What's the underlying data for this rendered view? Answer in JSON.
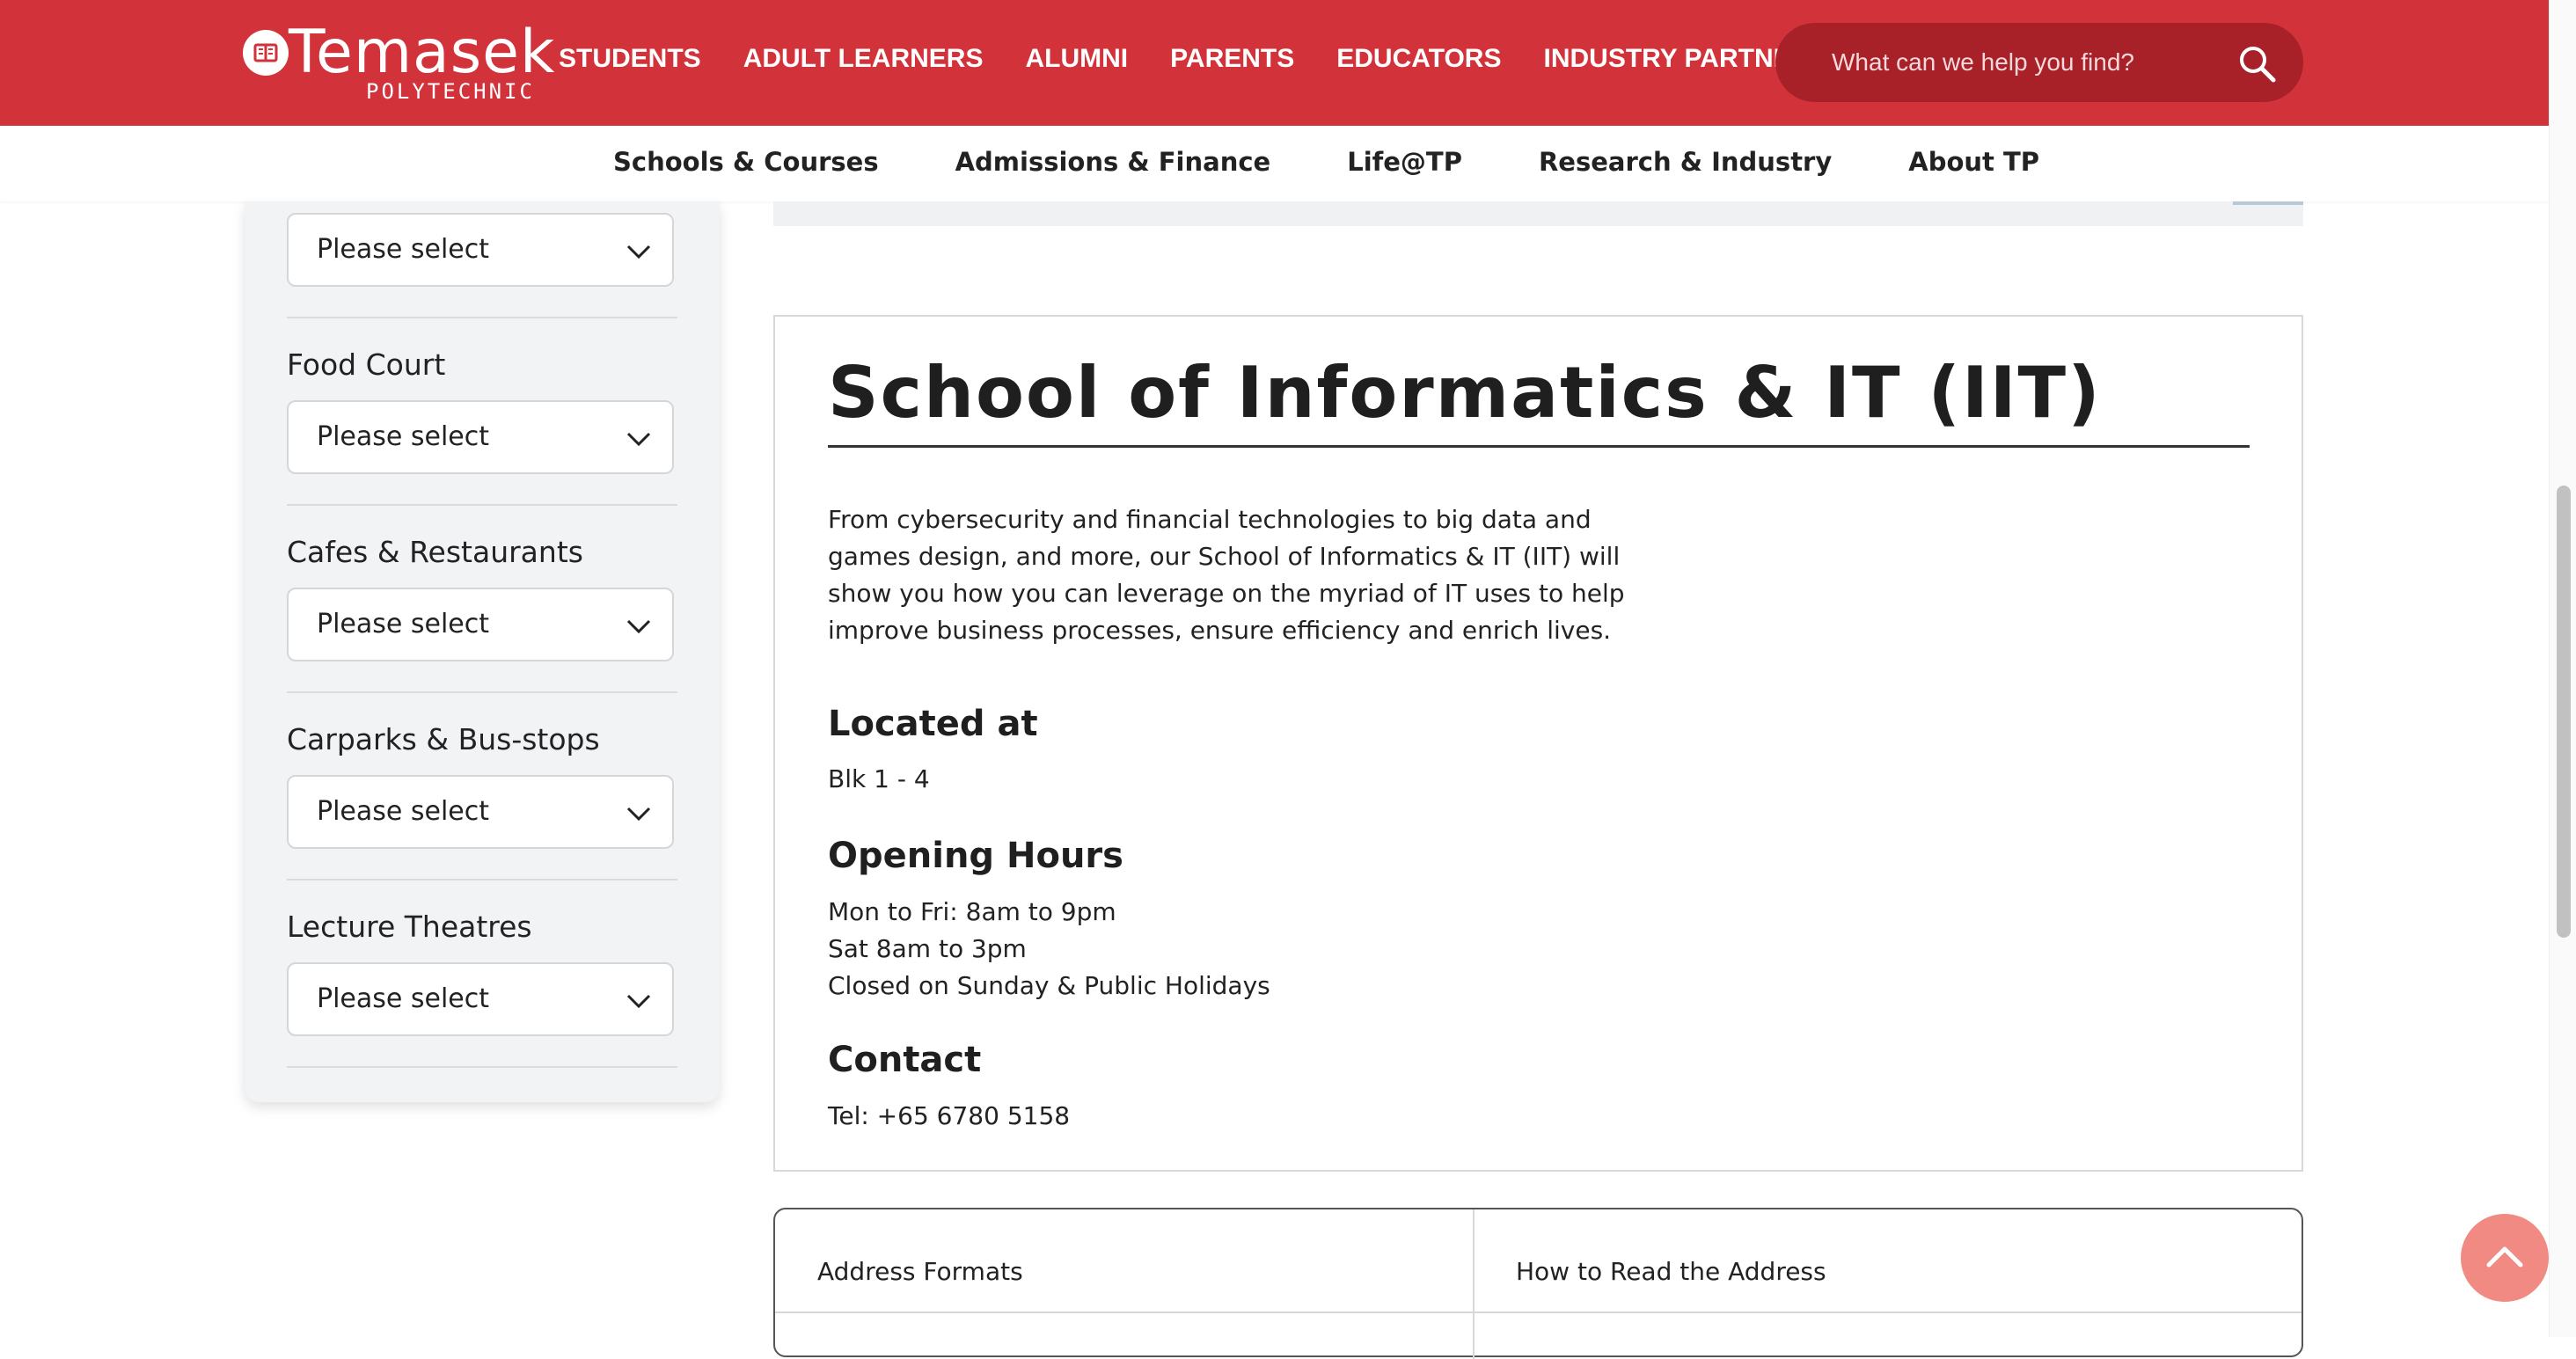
{
  "header": {
    "brand": "Temasek",
    "brand_sub": "POLYTECHNIC",
    "nav": [
      "STUDENTS",
      "ADULT LEARNERS",
      "ALUMNI",
      "PARENTS",
      "EDUCATORS",
      "INDUSTRY PARTNERS"
    ],
    "search_placeholder": "What can we help you find?",
    "search_icon": "search-icon"
  },
  "subnav": [
    "Schools & Courses",
    "Admissions & Finance",
    "Life@TP",
    "Research & Industry",
    "About TP"
  ],
  "filters": {
    "top_select": "Please select",
    "groups": [
      {
        "label": "Food Court",
        "value": "Please select"
      },
      {
        "label": "Cafes & Restaurants",
        "value": "Please select"
      },
      {
        "label": "Carparks & Bus-stops",
        "value": "Please select"
      },
      {
        "label": "Lecture Theatres",
        "value": "Please select"
      }
    ]
  },
  "main": {
    "title": "School of Informatics & IT (IIT)",
    "intro": "From cybersecurity and financial technologies to big data and games design, and more, our School of Informatics & IT (IIT) will show you how you can leverage on the myriad of IT uses to help improve business processes, ensure efficiency and enrich lives.",
    "located_heading": "Located at",
    "located": "Blk 1 - 4",
    "hours_heading": "Opening Hours",
    "hours": [
      "Mon to Fri: 8am to 9pm",
      "Sat 8am to 3pm",
      "Closed on Sunday & Public Holidays"
    ],
    "contact_heading": "Contact",
    "contact": "Tel: +65 6780 5158"
  },
  "address_table": {
    "headers": [
      "Address Formats",
      "How to Read the Address"
    ]
  },
  "colors": {
    "brand_red": "#d2323a",
    "search_bg": "#a82028",
    "back_to_top": "#f08a82"
  }
}
